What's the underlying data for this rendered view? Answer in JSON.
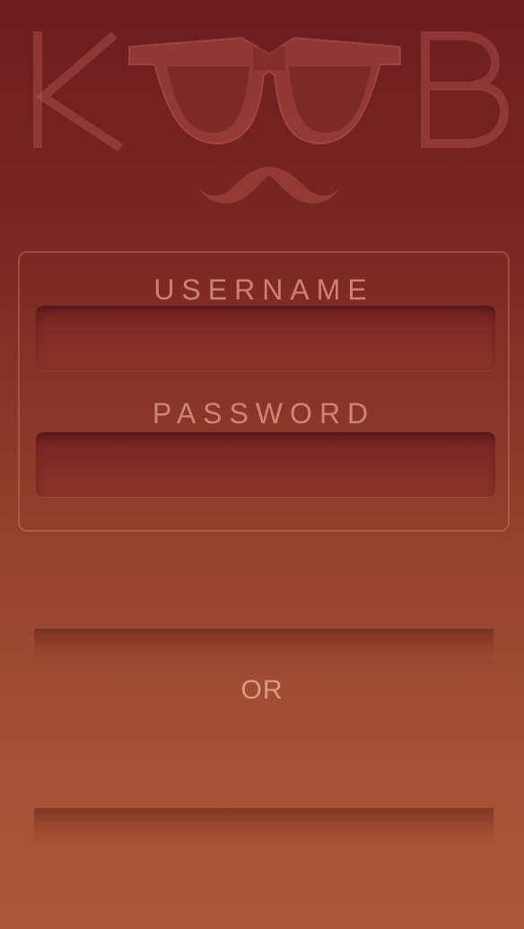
{
  "brand": {
    "logo_text": "KOOB"
  },
  "login": {
    "username_label": "USERNAME",
    "username_value": "",
    "password_label": "PASSWORD",
    "password_value": ""
  },
  "divider": {
    "or_label": "OR"
  },
  "colors": {
    "background_top": "#6b1d1f",
    "background_bottom": "#ad5638",
    "text_muted": "#e6a08c"
  }
}
